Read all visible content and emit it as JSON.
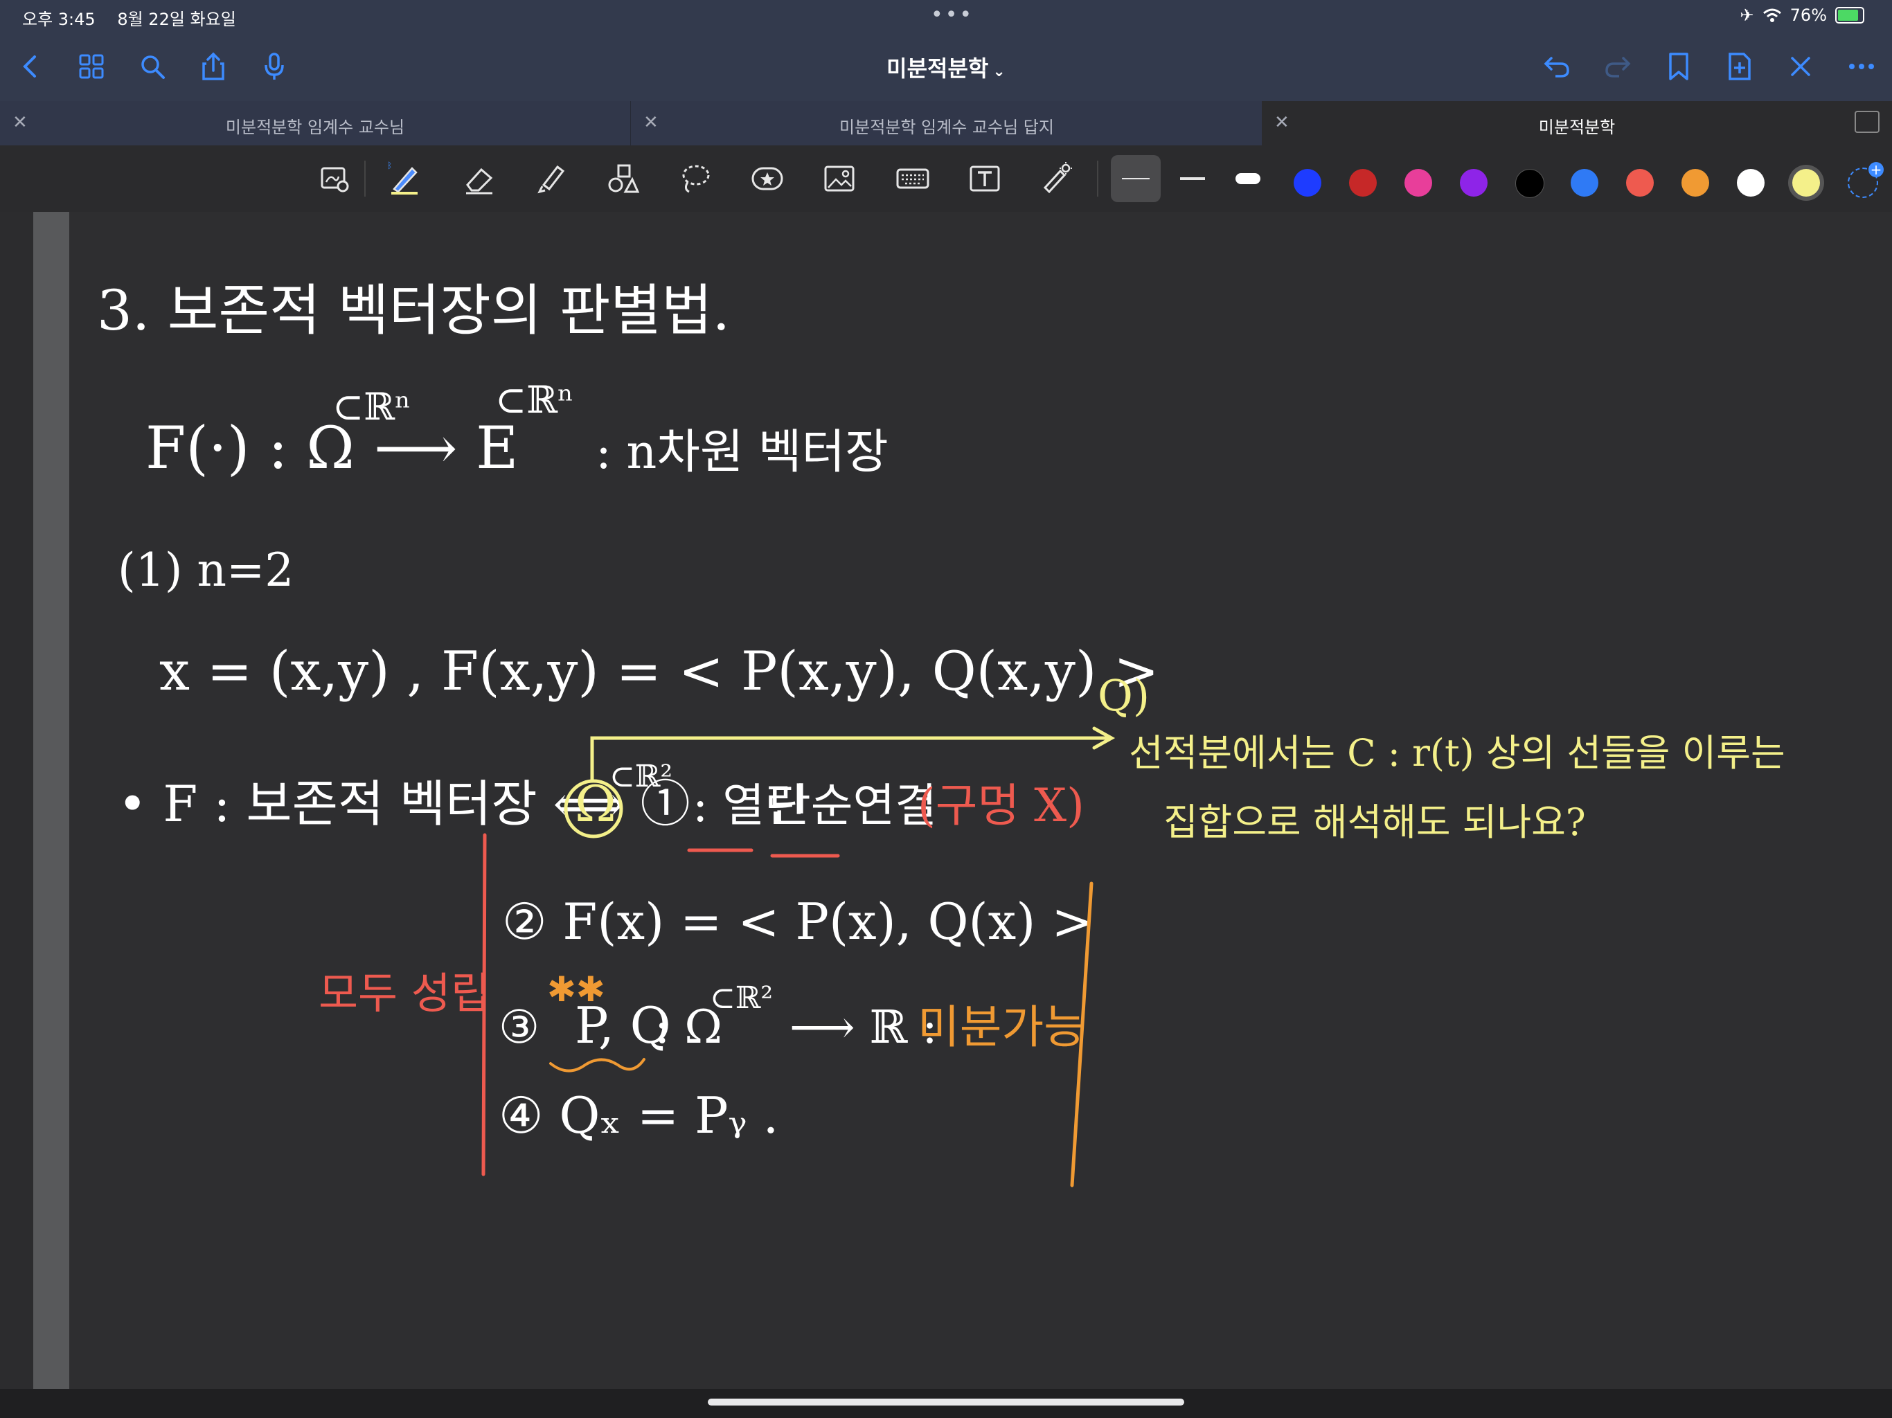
{
  "status": {
    "time": "오후 3:45",
    "date": "8월 22일 화요일",
    "battery": "76%"
  },
  "nav": {
    "doc_title": "미분적분학"
  },
  "tabs": [
    {
      "label": "미분적분학 임계수 교수님",
      "active": false
    },
    {
      "label": "미분적분학 임계수 교수님 답지",
      "active": false
    },
    {
      "label": "미분적분학",
      "active": true
    }
  ],
  "toolbar": {
    "colors": [
      "#1e3cff",
      "#c62828",
      "#e83e9a",
      "#8e24e8",
      "#000000",
      "#2f7af5",
      "#ee5a4f",
      "#f09a33",
      "#ffffff",
      "#f4f08a"
    ],
    "selected_color": "#f4f08a"
  },
  "notes": {
    "heading": "3. 보존적 벡터장의 판별법.",
    "line1_lhs": "F(·) : Ω",
    "line1_sup1": "⊂ℝⁿ",
    "line1_arrow": "⟶ E",
    "line1_sup2": "⊂ℝⁿ",
    "line1_rhs": ": n차원 벡터장",
    "case1": "(1)   n=2",
    "def_line": "x = (x,y) ,  F(x,y) = < P(x,y), Q(x,y) >",
    "cond_lhs": "• F : 보존적 벡터장  ⟺  ①",
    "omega": "Ω",
    "omega_sup": "⊂ℝ²",
    "cond1_a": ": 열린",
    "cond1_b": "단순연결",
    "cond1_red": "(구멍 X)",
    "cond2": "② F(x) = < P(x), Q(x) >",
    "cond3_a": "③",
    "cond3_pq": "P, Q",
    "cond3_b": ": Ω",
    "cond3_sup": "⊂ℝ²",
    "cond3_c": "⟶ ℝ :",
    "cond3_orange": "미분가능",
    "cond4": "④   Qₓ = Pᵧ .",
    "red_side": "모두 성립",
    "q_label": "Q)",
    "q_line1": "선적분에서는   C : r(t) 상의 선들을 이루는",
    "q_line2": "집합으로 해석해도 되나요?"
  }
}
